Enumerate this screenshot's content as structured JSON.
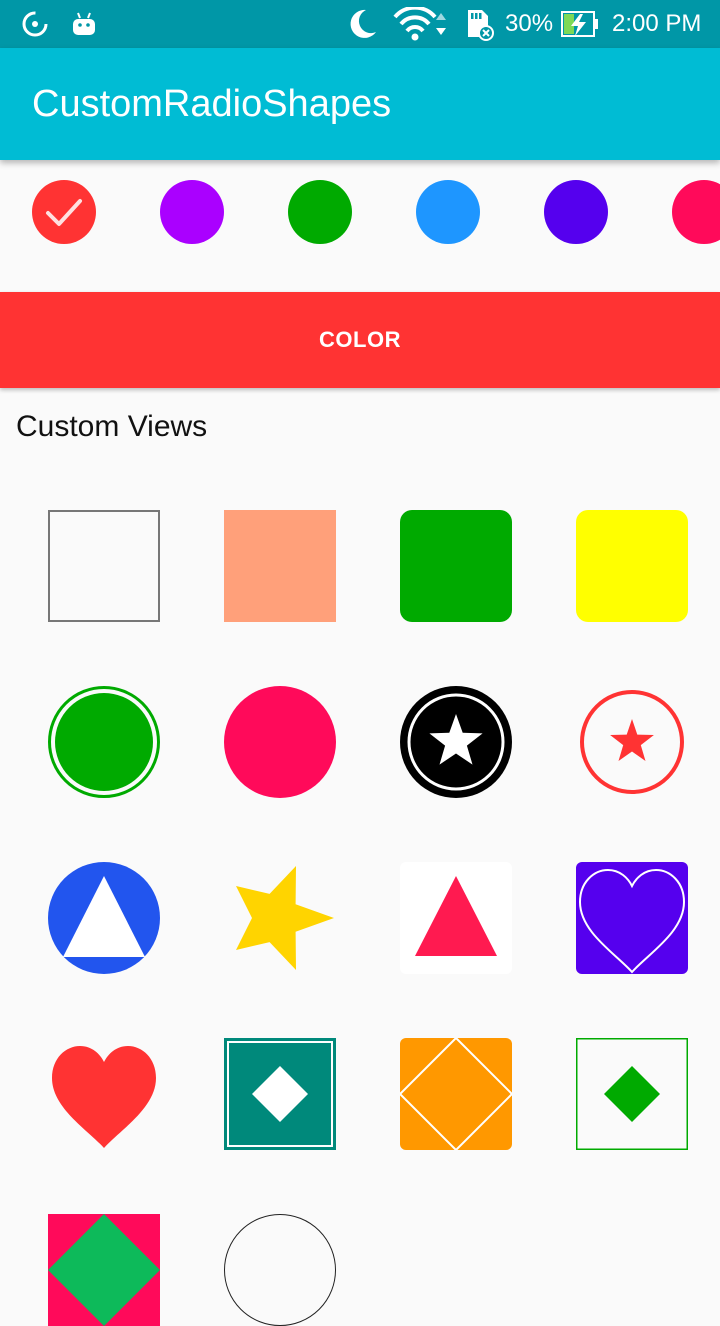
{
  "status_bar": {
    "battery": "30%",
    "time": "2:00 PM",
    "icons": [
      "data-saver-icon",
      "android-icon",
      "moon-icon",
      "wifi-icon",
      "sd-card-icon",
      "battery-charging-icon"
    ]
  },
  "app_bar": {
    "title": "CustomRadioShapes"
  },
  "color_options": [
    {
      "name": "red",
      "color": "#ff3333",
      "selected": true
    },
    {
      "name": "purple",
      "color": "#aa00ff",
      "selected": false
    },
    {
      "name": "green",
      "color": "#00aa00",
      "selected": false
    },
    {
      "name": "blue",
      "color": "#1e96ff",
      "selected": false
    },
    {
      "name": "indigo",
      "color": "#5500ee",
      "selected": false
    },
    {
      "name": "pink",
      "color": "#ff0a5a",
      "selected": false
    }
  ],
  "color_button": {
    "label": "COLOR",
    "color": "#ff3333"
  },
  "custom_views": {
    "title": "Custom Views",
    "shapes": [
      {
        "name": "outlined-square",
        "colors": [
          "#777777"
        ]
      },
      {
        "name": "filled-square",
        "colors": [
          "#ffa07a"
        ]
      },
      {
        "name": "rounded-square",
        "colors": [
          "#00aa00"
        ]
      },
      {
        "name": "rounded-square",
        "colors": [
          "#ffff00"
        ]
      },
      {
        "name": "ringed-circle",
        "colors": [
          "#00aa00"
        ]
      },
      {
        "name": "filled-circle",
        "colors": [
          "#ff0a5a"
        ]
      },
      {
        "name": "star-in-circle",
        "colors": [
          "#000000",
          "#ffffff"
        ]
      },
      {
        "name": "star-in-ring",
        "colors": [
          "#ff3333"
        ]
      },
      {
        "name": "triangle-in-circle",
        "colors": [
          "#2255ee",
          "#ffffff"
        ]
      },
      {
        "name": "star",
        "colors": [
          "#ffd400"
        ]
      },
      {
        "name": "triangle-in-square",
        "colors": [
          "#ff1a50",
          "#ffffff"
        ]
      },
      {
        "name": "heart-in-square",
        "colors": [
          "#5500ee",
          "#ffffff"
        ]
      },
      {
        "name": "heart",
        "colors": [
          "#ff3333"
        ]
      },
      {
        "name": "diamond-in-square",
        "colors": [
          "#00897b",
          "#ffffff"
        ]
      },
      {
        "name": "diamond-outline-square",
        "colors": [
          "#ff9800",
          "#ffffff"
        ]
      },
      {
        "name": "diamond-in-outlined-square",
        "colors": [
          "#00aa00"
        ]
      },
      {
        "name": "diamond-on-square",
        "colors": [
          "#ff0a5a",
          "#0dba5a"
        ]
      },
      {
        "name": "outlined-circle",
        "colors": [
          "#222222"
        ]
      }
    ]
  }
}
